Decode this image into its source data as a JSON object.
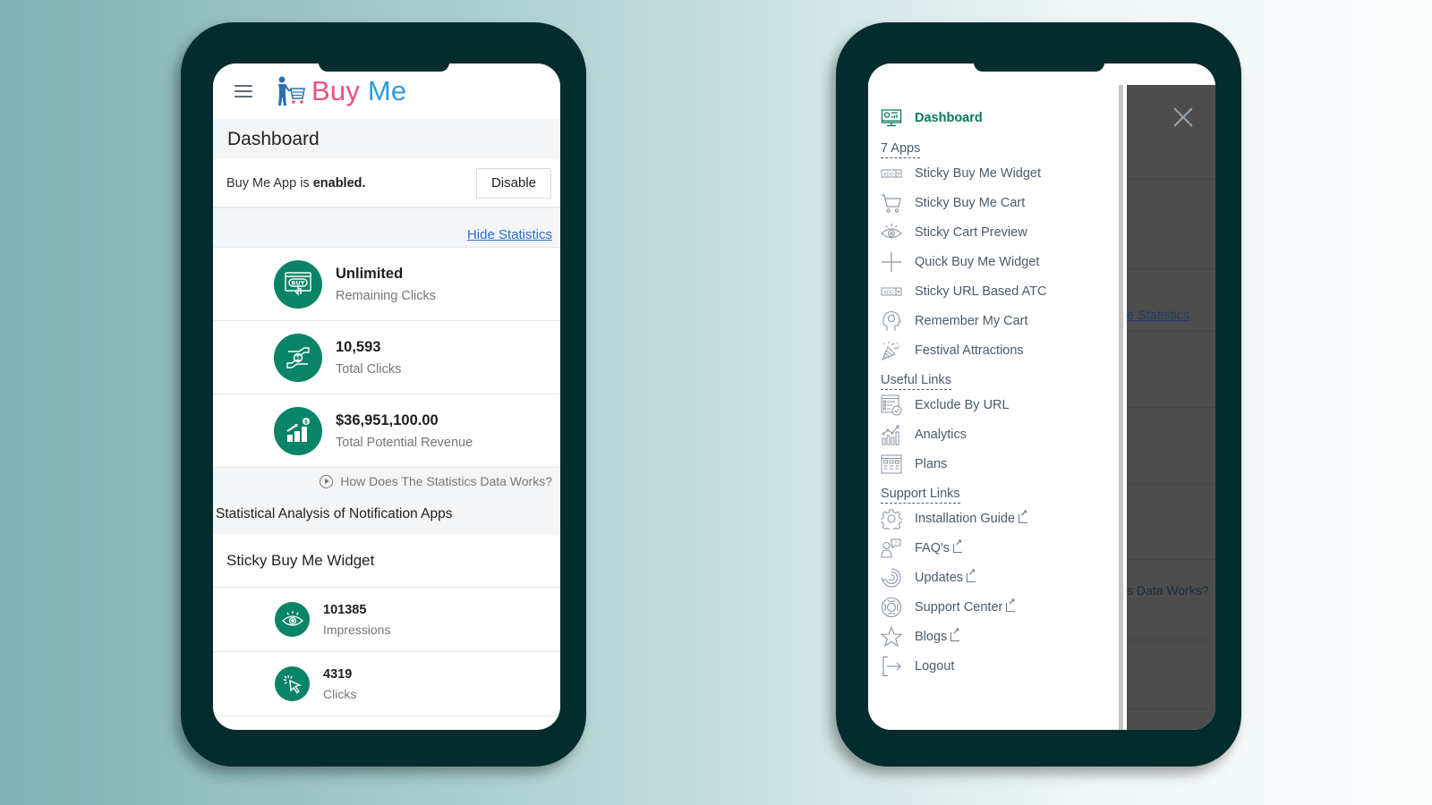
{
  "left_phone": {
    "header": {
      "menu_icon": "hamburger-icon",
      "logo_icon": "shopper-with-cart-icon",
      "logo_word1": "Buy",
      "logo_word2": "Me",
      "colors": {
        "buy": "#f04e83",
        "me": "#2d9be6"
      }
    },
    "page_title": "Dashboard",
    "status": {
      "prefix": "Buy Me App is ",
      "state": "enabled.",
      "button_label": "Disable"
    },
    "hide_statistics_label": "Hide Statistics",
    "stats": [
      {
        "icon": "buy-button-click-icon",
        "value": "Unlimited",
        "label": "Remaining Clicks"
      },
      {
        "icon": "hand-coin-icon",
        "value": "10,593",
        "label": "Total Clicks"
      },
      {
        "icon": "revenue-growth-chart-icon",
        "value": "$36,951,100.00",
        "label": "Total Potential Revenue"
      }
    ],
    "how_it_works": {
      "icon": "play-circle-icon",
      "label": "How Does The Statistics Data Works?"
    },
    "analysis_title": "Statistical Analysis of Notification Apps",
    "widget": {
      "title": "Sticky Buy Me Widget",
      "metrics": [
        {
          "icon": "eye-icon",
          "value": "101385",
          "label": "Impressions"
        },
        {
          "icon": "cursor-click-icon",
          "value": "4319",
          "label": "Clicks"
        }
      ]
    },
    "accent_color": "#0a8466"
  },
  "right_phone": {
    "drawer": {
      "active_item": {
        "icon": "dashboard-monitor-icon",
        "label": "Dashboard"
      },
      "sections": [
        {
          "title": "7 Apps",
          "items": [
            {
              "icon": "add-button-icon",
              "label": "Sticky Buy Me Widget"
            },
            {
              "icon": "cart-icon",
              "label": "Sticky Buy Me Cart"
            },
            {
              "icon": "eye-icon",
              "label": "Sticky Cart Preview"
            },
            {
              "icon": "plus-icon",
              "label": "Quick Buy Me Widget"
            },
            {
              "icon": "add-button-icon",
              "label": "Sticky URL Based ATC"
            },
            {
              "icon": "head-memory-icon",
              "label": "Remember My Cart"
            },
            {
              "icon": "party-popper-icon",
              "label": "Festival Attractions"
            }
          ]
        },
        {
          "title": "Useful Links",
          "items": [
            {
              "icon": "list-check-icon",
              "label": "Exclude By URL"
            },
            {
              "icon": "analytics-chart-icon",
              "label": "Analytics"
            },
            {
              "icon": "plans-grid-icon",
              "label": "Plans"
            }
          ]
        },
        {
          "title": "Support Links",
          "items": [
            {
              "icon": "gear-icon",
              "label": "Installation Guide",
              "external": true
            },
            {
              "icon": "faq-person-icon",
              "label": "FAQ's",
              "external": true
            },
            {
              "icon": "updates-refresh-icon",
              "label": "Updates",
              "external": true
            },
            {
              "icon": "lifebuoy-icon",
              "label": "Support Center",
              "external": true
            },
            {
              "icon": "star-icon",
              "label": "Blogs",
              "external": true
            },
            {
              "icon": "logout-icon",
              "label": "Logout"
            }
          ]
        }
      ]
    },
    "close_icon": "close-icon",
    "backdrop_ghost": {
      "hide_stats_fragment": "e Statistics",
      "how_fragment": "s Data Works?"
    }
  }
}
